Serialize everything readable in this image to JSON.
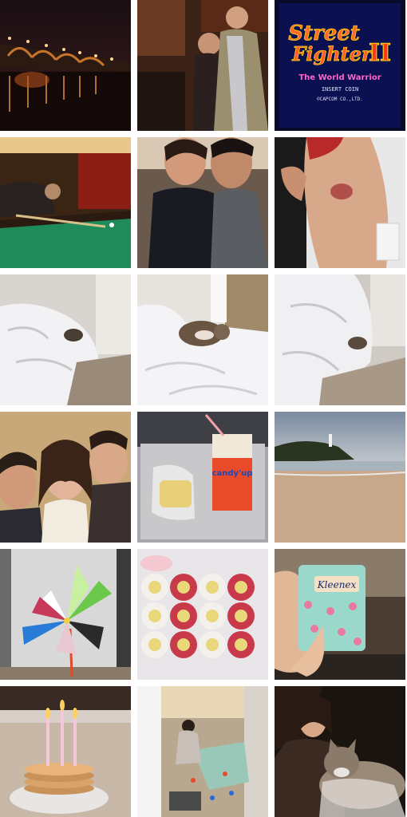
{
  "grid": {
    "background": "#ffffff",
    "columns": 3,
    "rows": 6
  },
  "tiles": [
    {
      "id": "night-bridge-reflection",
      "subject": "bridge lit at night reflected in river"
    },
    {
      "id": "arcade-players",
      "subject": "people playing arcade game"
    },
    {
      "id": "street-fighter-screen",
      "subject": "arcade title screen",
      "title_line1": "Street",
      "title_line2": "Fighter",
      "title_numeral": "II",
      "subtitle": "The World Warrior",
      "insert_coin": "INSERT COIN",
      "copyright": "©CAPCOM CO.,LTD."
    },
    {
      "id": "pool-table-shot",
      "subject": "man playing pool"
    },
    {
      "id": "couple-selfie",
      "subject": "couple selfie"
    },
    {
      "id": "arm-bruise",
      "subject": "arm with red mark"
    },
    {
      "id": "bed-cat-1",
      "subject": "cat under white duvet"
    },
    {
      "id": "bed-cat-2",
      "subject": "cat lying on bed"
    },
    {
      "id": "bed-cat-3",
      "subject": "cat peeking from duvet"
    },
    {
      "id": "funny-faces-trio",
      "subject": "three people making faces"
    },
    {
      "id": "snack-juice-box",
      "subject": "juice box and pastry on tray",
      "juice_label": "candy'up"
    },
    {
      "id": "beach-lighthouse",
      "subject": "beach with lighthouse on cliff"
    },
    {
      "id": "paper-pinwheel",
      "subject": "colorful paper pinwheel"
    },
    {
      "id": "sushi-rolls",
      "subject": "tray of sushi rolls"
    },
    {
      "id": "kleenex-pack",
      "subject": "tissue pack with cupcake print",
      "brand": "Kleenex"
    },
    {
      "id": "birthday-pancakes",
      "subject": "pancake stack with candles"
    },
    {
      "id": "kids-playroom",
      "subject": "child playing with toys on floor"
    },
    {
      "id": "woman-with-cat",
      "subject": "woman holding tabby cat"
    }
  ]
}
